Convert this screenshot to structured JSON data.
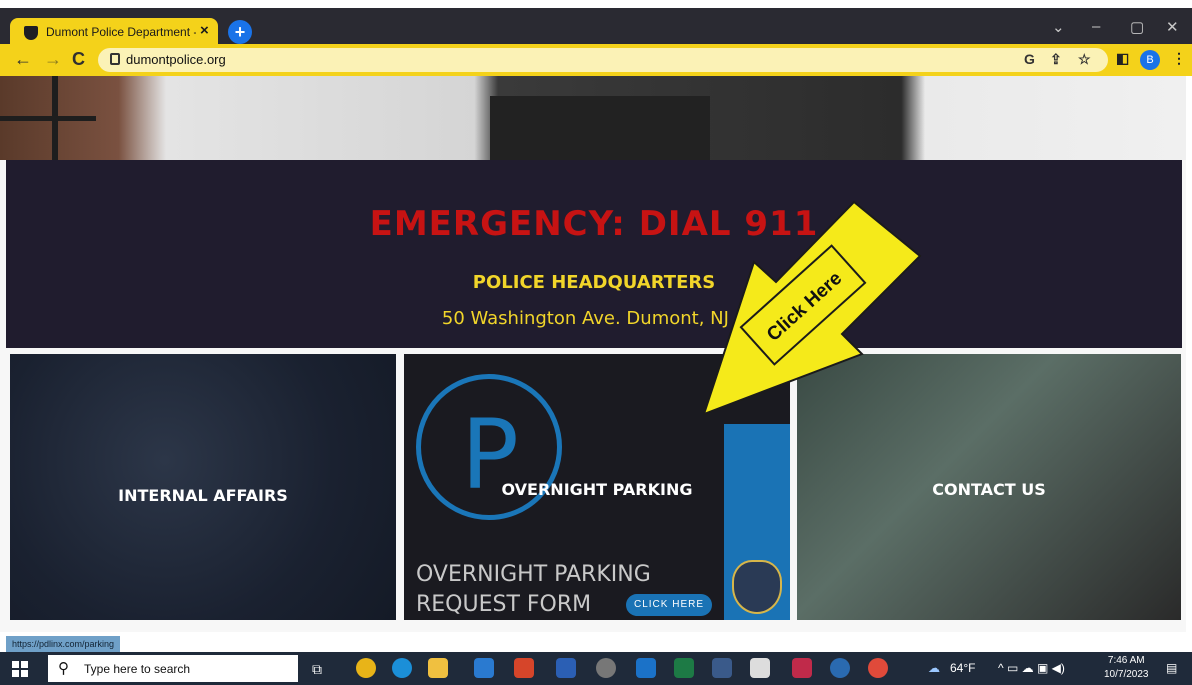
{
  "browser": {
    "tab_title": "Dumont Police Department - H",
    "tab_close": "×",
    "new_tab": "+",
    "url": "dumontpolice.org",
    "window_controls": [
      "⌄",
      "–",
      "▢",
      "✕"
    ],
    "omnibox_icons": [
      "G",
      "⇪",
      "☆"
    ],
    "profile_letter": "B",
    "menu": "⋮"
  },
  "banner": {
    "emergency": "EMERGENCY: DIAL 911",
    "hq_title": "POLICE HEADQUARTERS",
    "hq_address": "50 Washington Ave. Dumont, NJ 0"
  },
  "tiles": {
    "internal_affairs": "INTERNAL AFFAIRS",
    "overnight_parking": "OVERNIGHT PARKING",
    "contact_us": "CONTACT US",
    "form_line1": "OVERNIGHT PARKING",
    "form_line2": "REQUEST FORM",
    "form_button": "CLICK HERE",
    "p_letter": "P"
  },
  "overlay": {
    "arrow_text": "Click Here",
    "arrow_color": "#f5ea1a"
  },
  "status_url": "https://pdlinx.com/parking",
  "taskbar": {
    "search_placeholder": "Type here to search",
    "weather": "64°F",
    "time": "7:46 AM",
    "date": "10/7/2023"
  }
}
